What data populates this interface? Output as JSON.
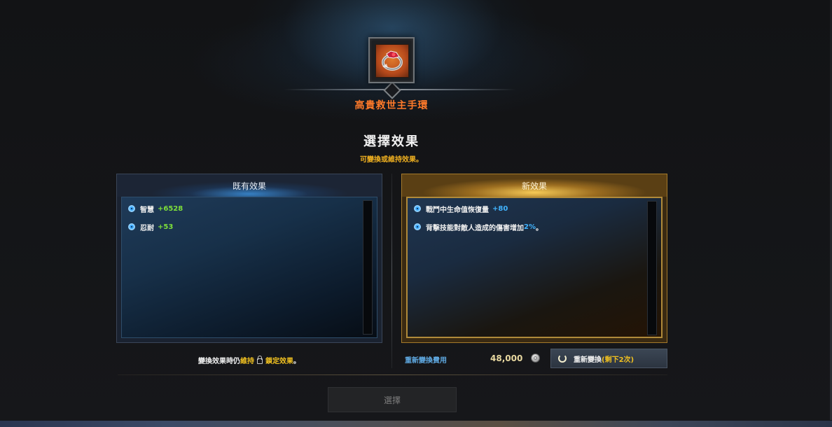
{
  "item": {
    "name": "高貴救世主手環",
    "icon": "bracelet-icon"
  },
  "header": {
    "title": "選擇效果",
    "subtitle": "可變換或維持效果。"
  },
  "existing_panel": {
    "title": "既有效果",
    "effects": [
      {
        "label": "智慧",
        "value": "+6528"
      },
      {
        "label": "忍耐",
        "value": "+53"
      }
    ]
  },
  "new_panel": {
    "title": "新效果",
    "effects": [
      {
        "label": "戰鬥中生命值恢復量",
        "value": "+80"
      },
      {
        "label_before": "背擊技能對敵人造成的傷害增加",
        "value": "2%",
        "label_after": "。"
      }
    ]
  },
  "lock_note": {
    "before": "變換效果時仍",
    "keep": "維持",
    "lock_icon": "lock-icon",
    "locked": "鎖定效果",
    "after": "。"
  },
  "cost": {
    "label": "重新變換費用",
    "value": "48,000",
    "currency_icon": "silver-coin-icon"
  },
  "reroll": {
    "label": "重新變換",
    "remaining": "(剩下2次)",
    "icon": "refresh-icon"
  },
  "select_button": {
    "label": "選擇"
  },
  "colors": {
    "item_name": "#ff7a2a",
    "subtitle": "#f0b020",
    "value_green": "#7ee03a",
    "value_blue": "#41b4ff",
    "new_panel_border": "#a57a2a"
  }
}
